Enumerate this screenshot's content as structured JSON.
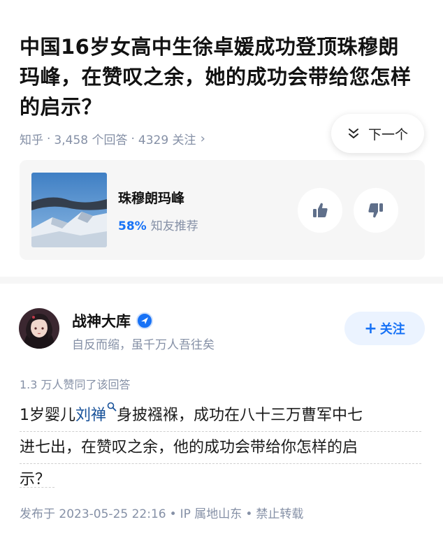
{
  "question": {
    "title_lines": [
      "中国16岁女高中生徐卓媛成功登顶珠穆朗",
      "玛峰，在赞叹之余，她的成功会带给您怎样",
      "的启示？"
    ],
    "source": "知乎",
    "answer_count": "3,458 个回答",
    "follow_count": "4329 关注",
    "next_label": "下一个"
  },
  "topic": {
    "name": "珠穆朗玛峰",
    "percent": "58%",
    "recommend_label": "知友推荐"
  },
  "author": {
    "name": "战神大库",
    "bio": "自反而缩，虽千万人吾往矣",
    "follow_label": "关注"
  },
  "answer": {
    "votes_text": "1.3 万人赞同了该回答",
    "line1_prefix": "1岁婴儿",
    "line1_link": "刘禅",
    "line1_suffix": "身披襁褓，成功在八十三万曹军中七",
    "line2": "进七出，在赞叹之余，他的成功会带给你怎样的启",
    "line3": "示？"
  },
  "publish": {
    "date": "发布于 2023-05-25 22:16",
    "ip": "IP 属地山东",
    "rights": "禁止转载"
  },
  "icons": {
    "next": "double-chevron-down-icon",
    "chevron": "chevron-right-icon",
    "thumbs_up": "thumbs-up-icon",
    "thumbs_down": "thumbs-down-icon",
    "verified": "verified-badge-icon",
    "search": "search-icon"
  },
  "colors": {
    "accent": "#1772f6",
    "muted": "#8590a6",
    "link": "#175199"
  }
}
